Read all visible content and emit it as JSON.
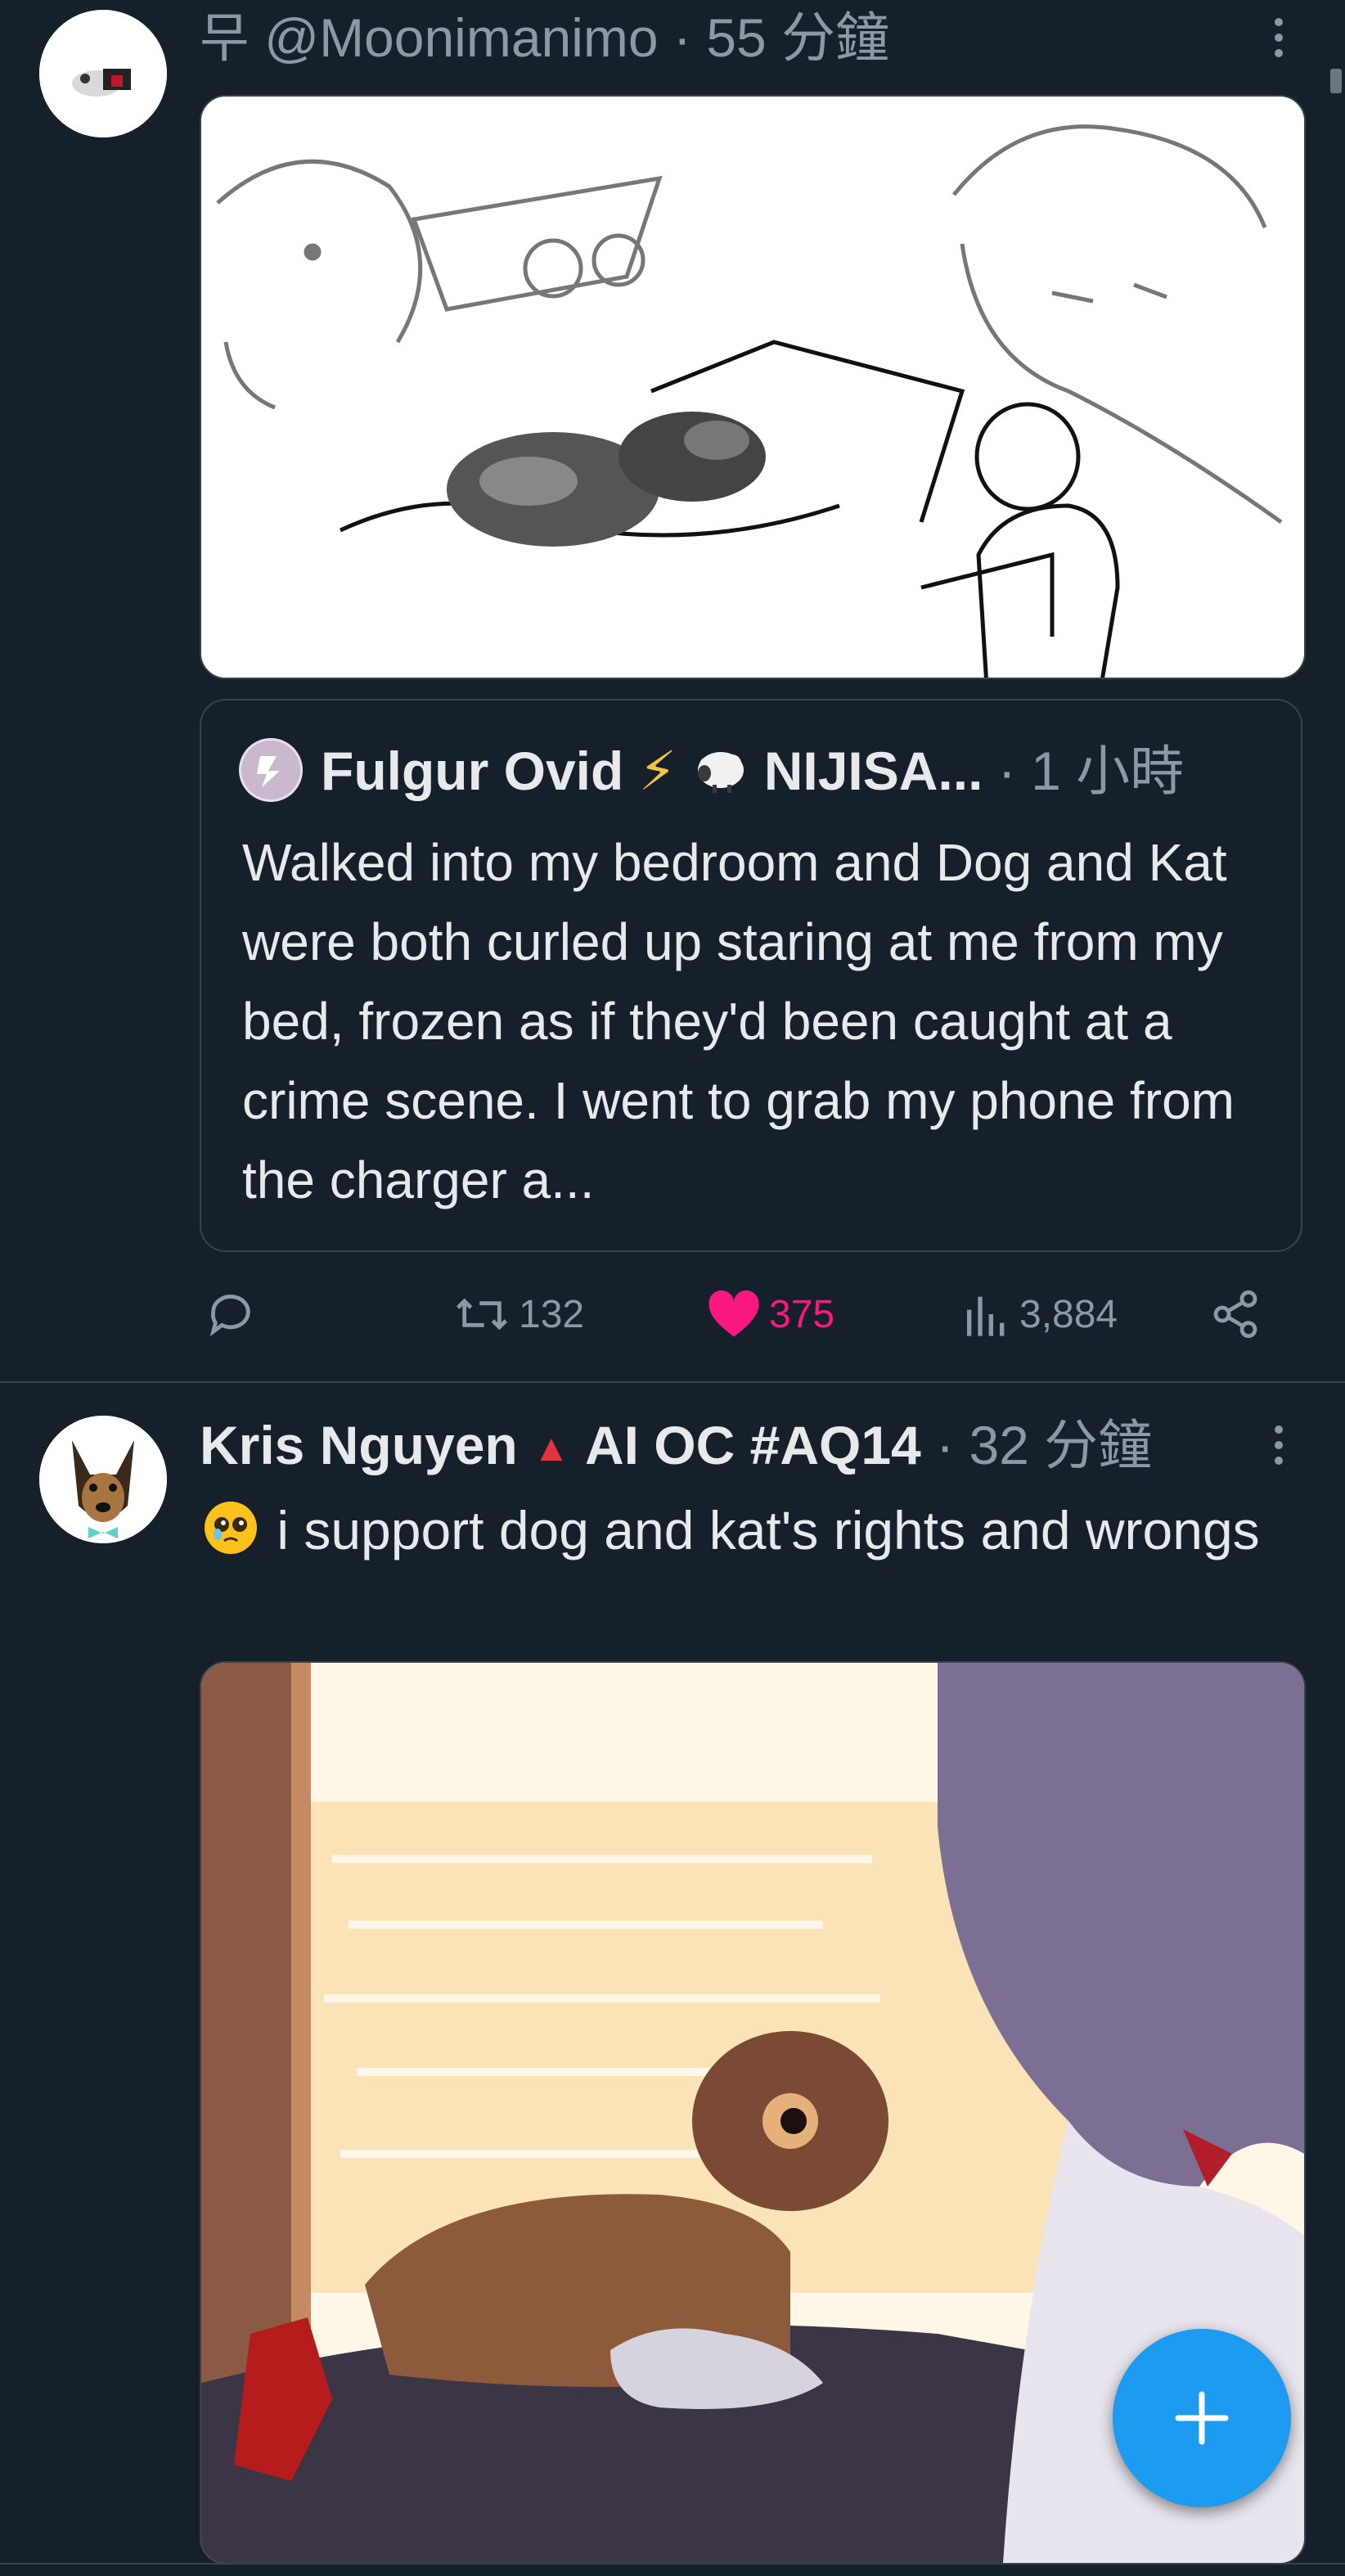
{
  "tweet1": {
    "handle_prefix": "무",
    "handle": "@Moonimanimo",
    "separator": "·",
    "time": "55 分鐘",
    "quote": {
      "display_name": "Fulgur Ovid",
      "name_suffix": "NIJISA...",
      "separator": "·",
      "time": "1 小時",
      "text": "Walked into my bedroom and Dog and Kat were both curled up staring at me from my bed, frozen as if they'd been caught at a crime scene. I went to grab my phone from the charger a..."
    },
    "actions": {
      "retweets": "132",
      "likes": "375",
      "views": "3,884"
    }
  },
  "tweet2": {
    "display_name": "Kris Nguyen",
    "name_suffix": "AI OC #AQ14",
    "separator": "·",
    "time": "32 分鐘",
    "text": "i support dog and kat's rights and wrongs"
  },
  "icons": {
    "reply": "reply-icon",
    "retweet": "retweet-icon",
    "like": "heart-icon",
    "views": "views-icon",
    "share": "share-icon",
    "compose": "plus-icon"
  },
  "colors": {
    "background": "#15202b",
    "like": "#f91880",
    "accent": "#1d9bf0",
    "muted": "#8b98a5"
  }
}
